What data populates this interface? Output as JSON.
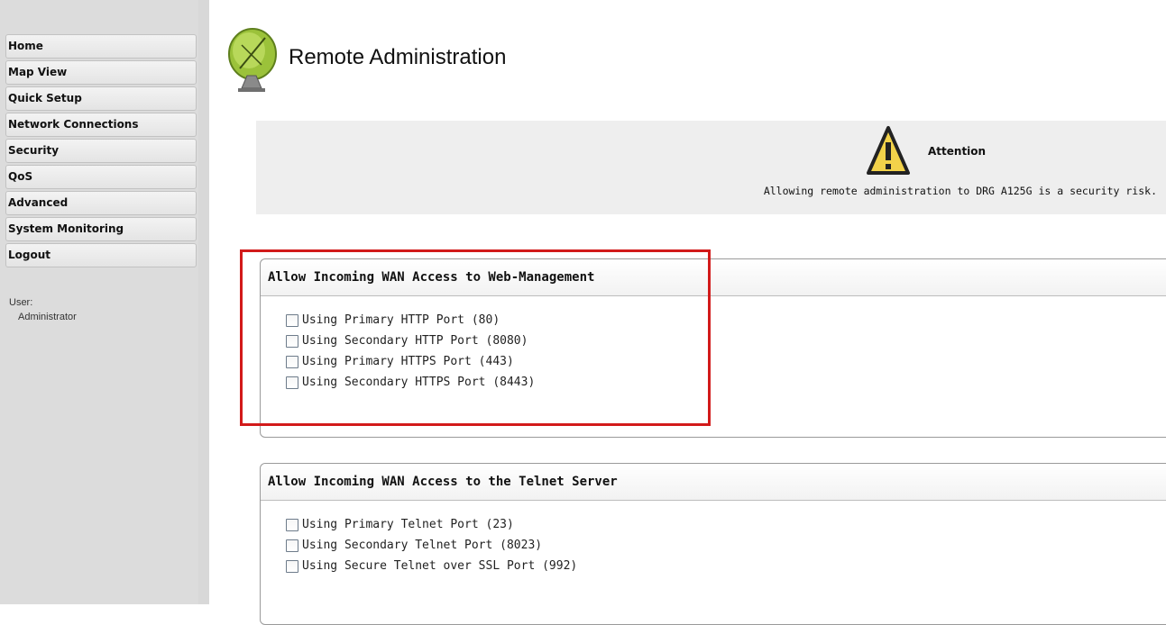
{
  "sidebar": {
    "items": [
      {
        "label": "Home"
      },
      {
        "label": "Map View"
      },
      {
        "label": "Quick Setup"
      },
      {
        "label": "Network Connections"
      },
      {
        "label": "Security"
      },
      {
        "label": "QoS"
      },
      {
        "label": "Advanced"
      },
      {
        "label": "System Monitoring"
      },
      {
        "label": "Logout"
      }
    ],
    "user_label": "User:",
    "user_name": "Administrator"
  },
  "page": {
    "title": "Remote Administration",
    "icon": "satellite-dish-icon"
  },
  "attention": {
    "icon": "warning-triangle-icon",
    "title": "Attention",
    "text": "Allowing remote administration to DRG A125G is a security risk."
  },
  "web_panel": {
    "title": "Allow Incoming WAN Access to Web-Management",
    "options": [
      {
        "label": "Using Primary HTTP Port (80)",
        "checked": false
      },
      {
        "label": "Using Secondary HTTP Port (8080)",
        "checked": false
      },
      {
        "label": "Using Primary HTTPS Port (443)",
        "checked": false
      },
      {
        "label": "Using Secondary HTTPS Port (8443)",
        "checked": false
      }
    ]
  },
  "telnet_panel": {
    "title": "Allow Incoming WAN Access to the Telnet Server",
    "options": [
      {
        "label": "Using Primary Telnet Port (23)",
        "checked": false
      },
      {
        "label": "Using Secondary Telnet Port (8023)",
        "checked": false
      },
      {
        "label": "Using Secure Telnet over SSL Port (992)",
        "checked": false
      }
    ]
  },
  "colors": {
    "highlight_border": "#d21a1a",
    "sidebar_bg": "#dcdcdc",
    "attention_bg": "#eeeeee"
  }
}
